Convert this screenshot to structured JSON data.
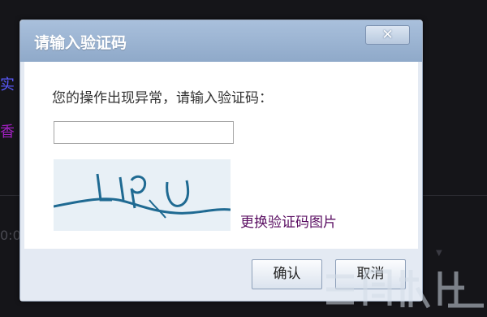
{
  "dialog": {
    "title": "请输入验证码",
    "close_symbol": "✕",
    "prompt": "您的操作出现异常，请输入验证码：",
    "input_value": "",
    "captcha_text": "Lipu",
    "refresh_link": "更换验证码图片",
    "ok_label": "确认",
    "cancel_label": "取消"
  },
  "background": {
    "line1": "实",
    "line2": "香",
    "line3": "0:0"
  },
  "colors": {
    "titlebar": "#9fb6d4",
    "link": "#5a0e62",
    "captcha_stroke": "#1f6a92"
  },
  "icons": {
    "close": "close-icon",
    "dropdown": "triangle-down-icon"
  }
}
